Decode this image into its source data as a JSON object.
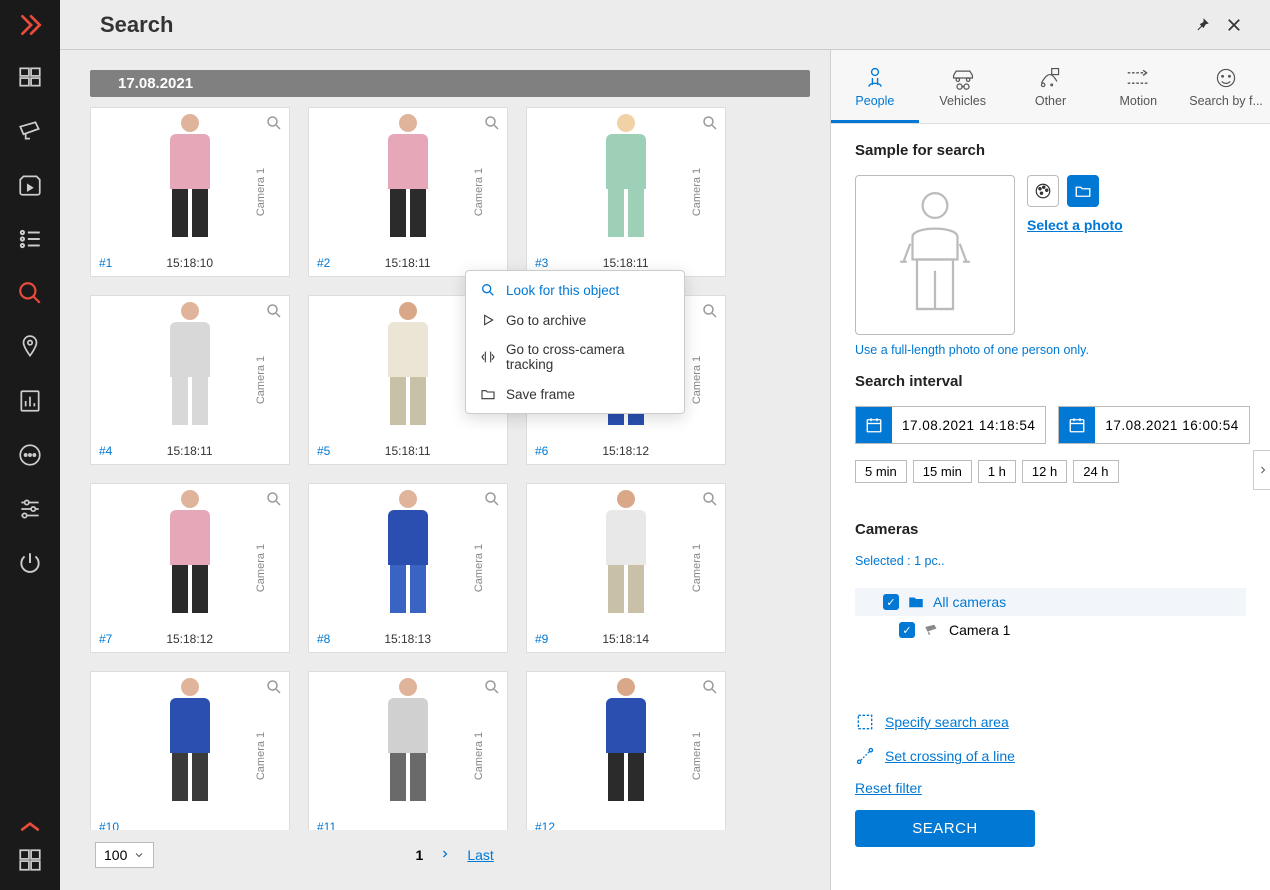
{
  "header": {
    "title": "Search"
  },
  "date_group": "17.08.2021",
  "results": [
    {
      "id": "#1",
      "time": "15:18:10",
      "camera": "Camera 1",
      "shirt": "#e6a8b8",
      "pants": "#2b2b2b",
      "skin": "#e0b49a"
    },
    {
      "id": "#2",
      "time": "15:18:11",
      "camera": "Camera 1",
      "shirt": "#e6a8b8",
      "pants": "#2b2b2b",
      "skin": "#e0b49a"
    },
    {
      "id": "#3",
      "time": "15:18:11",
      "camera": "Camera 1",
      "shirt": "#9dd0b6",
      "pants": "#9dd0b6",
      "skin": "#f0d2a6"
    },
    {
      "id": "#4",
      "time": "15:18:11",
      "camera": "Camera 1",
      "shirt": "#d8d8d8",
      "pants": "#d8d8d8",
      "skin": "#e0b49a"
    },
    {
      "id": "#5",
      "time": "15:18:11",
      "camera": "Camera 1",
      "shirt": "#ece5d5",
      "pants": "#c9c0a8",
      "skin": "#d9a888"
    },
    {
      "id": "#6",
      "time": "15:18:12",
      "camera": "Camera 1",
      "shirt": "#2a4fb0",
      "pants": "#2a4fb0",
      "skin": "#e0b49a"
    },
    {
      "id": "#7",
      "time": "15:18:12",
      "camera": "Camera 1",
      "shirt": "#e6a8b8",
      "pants": "#2b2b2b",
      "skin": "#e0b49a"
    },
    {
      "id": "#8",
      "time": "15:18:13",
      "camera": "Camera 1",
      "shirt": "#2a4fb0",
      "pants": "#3a64c4",
      "skin": "#e0b49a"
    },
    {
      "id": "#9",
      "time": "15:18:14",
      "camera": "Camera 1",
      "shirt": "#e8e8e8",
      "pants": "#c9c0a8",
      "skin": "#d9a888"
    },
    {
      "id": "#10",
      "time": "",
      "camera": "Camera 1",
      "shirt": "#2a4fb0",
      "pants": "#3a3a3a",
      "skin": "#e0b49a"
    },
    {
      "id": "#11",
      "time": "",
      "camera": "Camera 1",
      "shirt": "#d0d0d0",
      "pants": "#6a6a6a",
      "skin": "#e0b49a"
    },
    {
      "id": "#12",
      "time": "",
      "camera": "Camera 1",
      "shirt": "#2a4fb0",
      "pants": "#2b2b2b",
      "skin": "#d9a888"
    }
  ],
  "context_menu": [
    {
      "icon": "search",
      "label": "Look for this object",
      "primary": true
    },
    {
      "icon": "play",
      "label": "Go to archive"
    },
    {
      "icon": "track",
      "label": "Go to cross-camera tracking"
    },
    {
      "icon": "folder",
      "label": "Save frame"
    }
  ],
  "pager": {
    "page_size": "100",
    "current": "1",
    "last_label": "Last"
  },
  "tabs": [
    {
      "key": "people",
      "label": "People",
      "active": true
    },
    {
      "key": "vehicles",
      "label": "Vehicles",
      "active": false
    },
    {
      "key": "other",
      "label": "Other",
      "active": false
    },
    {
      "key": "motion",
      "label": "Motion",
      "active": false
    },
    {
      "key": "face",
      "label": "Search by f...",
      "active": false
    }
  ],
  "sample": {
    "title": "Sample for search",
    "select_photo": "Select a photo",
    "hint": "Use a full-length photo of one person only."
  },
  "interval": {
    "title": "Search interval",
    "from": "17.08.2021  14:18:54",
    "to": "17.08.2021  16:00:54",
    "quick": [
      "5 min",
      "15 min",
      "1 h",
      "12 h",
      "24 h"
    ]
  },
  "cameras": {
    "title": "Cameras",
    "selected_label": "Selected :",
    "selected_value": "1 pc..",
    "root": "All cameras",
    "items": [
      "Camera 1"
    ]
  },
  "actions": {
    "specify_area": "Specify search area",
    "crossing_line": "Set crossing of a line",
    "reset": "Reset filter",
    "search": "SEARCH"
  }
}
